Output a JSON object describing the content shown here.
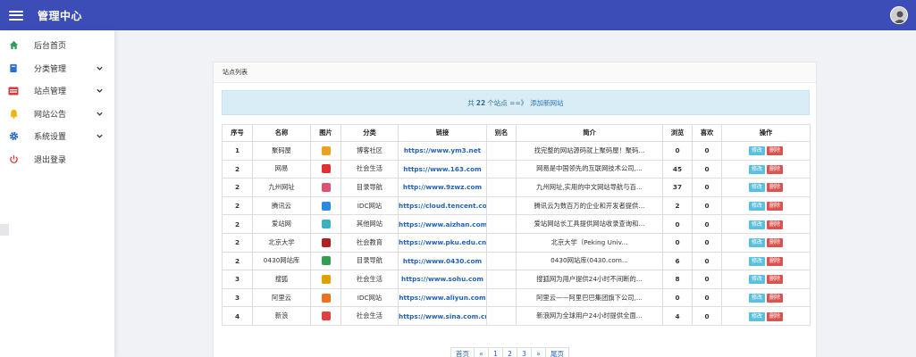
{
  "header": {
    "title": "管理中心"
  },
  "sidebar": {
    "items": [
      {
        "label": "后台首页",
        "icon": "home-icon",
        "color": "#2e9e5b",
        "expandable": false
      },
      {
        "label": "分类管理",
        "icon": "book-icon",
        "color": "#2a6fd6",
        "expandable": true
      },
      {
        "label": "站点管理",
        "icon": "monitor-icon",
        "color": "#d63c3c",
        "expandable": true
      },
      {
        "label": "网站公告",
        "icon": "bell-icon",
        "color": "#f0b400",
        "expandable": true
      },
      {
        "label": "系统设置",
        "icon": "gear-icon",
        "color": "#1d5fbf",
        "expandable": true
      },
      {
        "label": "退出登录",
        "icon": "power-icon",
        "color": "#d63c3c",
        "expandable": false
      }
    ]
  },
  "card": {
    "title": "站点列表",
    "summary": {
      "prefix": "共",
      "count": "22",
      "suffix": "个站点 ==》",
      "link": "添加新网站"
    }
  },
  "table": {
    "columns": [
      "序号",
      "名称",
      "图片",
      "分类",
      "链接",
      "别名",
      "简介",
      "浏览",
      "喜欢",
      "操作"
    ],
    "rows": [
      {
        "seq": "1",
        "name": "聚码屋",
        "icon": "#f0a020",
        "category": "博客社区",
        "url": "https://www.ym3.net",
        "alias": "",
        "intro": "找完整的网站源码就上聚码屋！聚码...",
        "views": "0",
        "likes": "0"
      },
      {
        "seq": "2",
        "name": "网易",
        "icon": "#e03030",
        "category": "社会生活",
        "url": "https://www.163.com",
        "alias": "",
        "intro": "网易是中国领先的互联网技术公司,...",
        "views": "45",
        "likes": "0"
      },
      {
        "seq": "2",
        "name": "九州网址",
        "icon": "#e05070",
        "category": "目录导航",
        "url": "http://www.9zwz.com",
        "alias": "",
        "intro": "九州网址,实用的中文网站导航与百...",
        "views": "37",
        "likes": "0"
      },
      {
        "seq": "2",
        "name": "腾讯云",
        "icon": "#2b8be0",
        "category": "IDC网站",
        "url": "https://cloud.tencent.com",
        "alias": "",
        "intro": "腾讯云为数百万的企业和开发者提供...",
        "views": "2",
        "likes": "0"
      },
      {
        "seq": "2",
        "name": "爱站网",
        "icon": "#3ab0c0",
        "category": "其他网站",
        "url": "https://www.aizhan.com",
        "alias": "",
        "intro": "爱站网站长工具提供网站收录查询和...",
        "views": "0",
        "likes": "0"
      },
      {
        "seq": "2",
        "name": "北京大学",
        "icon": "#b02020",
        "category": "社会教育",
        "url": "https://www.pku.edu.cn",
        "alias": "",
        "intro": "北京大学（Peking Univ...",
        "views": "0",
        "likes": "0"
      },
      {
        "seq": "2",
        "name": "0430网站库",
        "icon": "#30a050",
        "category": "目录导航",
        "url": "http://www.0430.com",
        "alias": "",
        "intro": "0430网站库(0430.com...",
        "views": "6",
        "likes": "0"
      },
      {
        "seq": "3",
        "name": "搜狐",
        "icon": "#e0a000",
        "category": "社会生活",
        "url": "https://www.sohu.com",
        "alias": "",
        "intro": "搜狐网为用户提供24小时不间断的...",
        "views": "8",
        "likes": "0"
      },
      {
        "seq": "3",
        "name": "阿里云",
        "icon": "#f07020",
        "category": "IDC网站",
        "url": "https://www.aliyun.com",
        "alias": "",
        "intro": "阿里云——阿里巴巴集团旗下公司,...",
        "views": "0",
        "likes": "0"
      },
      {
        "seq": "4",
        "name": "新浪",
        "icon": "#e04040",
        "category": "社会生活",
        "url": "https://www.sina.com.cn",
        "alias": "",
        "intro": "新浪网为全球用户24小时提供全面...",
        "views": "4",
        "likes": "0"
      }
    ],
    "actions": {
      "edit": "修改",
      "delete": "删除"
    }
  },
  "pagination": [
    "首页",
    "«",
    "1",
    "2",
    "3",
    "»",
    "尾页"
  ]
}
